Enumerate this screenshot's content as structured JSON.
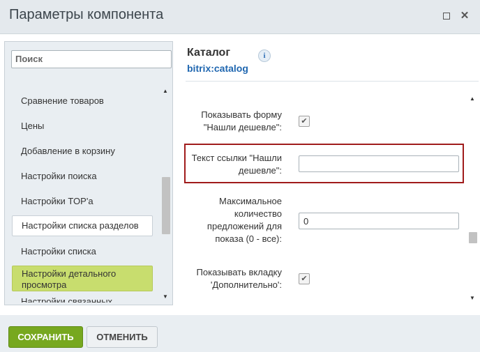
{
  "window": {
    "title": "Параметры компонента"
  },
  "sidebar": {
    "search_placeholder": "Поиск",
    "items": [
      {
        "label": "Сравнение товаров"
      },
      {
        "label": "Цены"
      },
      {
        "label": "Добавление в корзину"
      },
      {
        "label": "Настройки поиска"
      },
      {
        "label": "Настройки TOP'а"
      },
      {
        "label": "Настройки списка разделов"
      },
      {
        "label": "Настройки списка"
      },
      {
        "label": "Настройки детального просмотра"
      },
      {
        "label": "Настройки связанных"
      }
    ]
  },
  "component": {
    "title": "Каталог",
    "code": "bitrix:catalog",
    "info_icon": "info-icon"
  },
  "form": {
    "fields": [
      {
        "label": "Показывать форму\n\"Нашли дешевле\":",
        "type": "checkbox",
        "checked": true
      },
      {
        "label": "Текст ссылки \"Нашли\nдешевле\":",
        "type": "text",
        "value": ""
      },
      {
        "label": "Максимальное\nколичество\nпредложений для\nпоказа (0 - все):",
        "type": "text",
        "value": "0"
      },
      {
        "label": "Показывать вкладку\n'Дополнительно':",
        "type": "checkbox",
        "checked": true
      }
    ]
  },
  "footer": {
    "save_label": "СОХРАНИТЬ",
    "cancel_label": "ОТМЕНИТЬ"
  },
  "colors": {
    "accent_green": "#77a81f",
    "active_item": "#c8dd6e",
    "link_blue": "#2067b0",
    "highlight_red": "#a01b1b"
  }
}
